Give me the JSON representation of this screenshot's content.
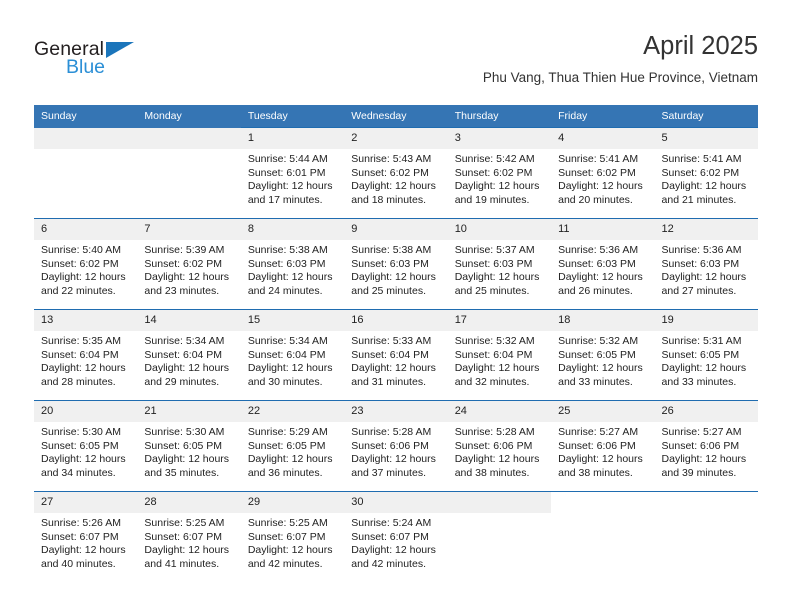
{
  "brand": {
    "name_top": "General",
    "name_bottom": "Blue",
    "triangle_color": "#1b75bb",
    "blue_text_color": "#2b8fd6"
  },
  "header": {
    "month_title": "April 2025",
    "location": "Phu Vang, Thua Thien Hue Province, Vietnam"
  },
  "theme": {
    "header_bg": "#3575b4",
    "row_rule": "#1f6cb0",
    "daynum_bg": "#f0f0f0"
  },
  "calendar": {
    "weekday_headers": [
      "Sunday",
      "Monday",
      "Tuesday",
      "Wednesday",
      "Thursday",
      "Friday",
      "Saturday"
    ],
    "labels": {
      "sunrise_prefix": "Sunrise:",
      "sunset_prefix": "Sunset:",
      "daylight_prefix": "Daylight:"
    },
    "weeks": [
      [
        {
          "day": "",
          "sunrise": "",
          "sunset": "",
          "daylight_line1": "",
          "daylight_line2": ""
        },
        {
          "day": "",
          "sunrise": "",
          "sunset": "",
          "daylight_line1": "",
          "daylight_line2": ""
        },
        {
          "day": "1",
          "sunrise": "Sunrise: 5:44 AM",
          "sunset": "Sunset: 6:01 PM",
          "daylight_line1": "Daylight: 12 hours",
          "daylight_line2": "and 17 minutes."
        },
        {
          "day": "2",
          "sunrise": "Sunrise: 5:43 AM",
          "sunset": "Sunset: 6:02 PM",
          "daylight_line1": "Daylight: 12 hours",
          "daylight_line2": "and 18 minutes."
        },
        {
          "day": "3",
          "sunrise": "Sunrise: 5:42 AM",
          "sunset": "Sunset: 6:02 PM",
          "daylight_line1": "Daylight: 12 hours",
          "daylight_line2": "and 19 minutes."
        },
        {
          "day": "4",
          "sunrise": "Sunrise: 5:41 AM",
          "sunset": "Sunset: 6:02 PM",
          "daylight_line1": "Daylight: 12 hours",
          "daylight_line2": "and 20 minutes."
        },
        {
          "day": "5",
          "sunrise": "Sunrise: 5:41 AM",
          "sunset": "Sunset: 6:02 PM",
          "daylight_line1": "Daylight: 12 hours",
          "daylight_line2": "and 21 minutes."
        }
      ],
      [
        {
          "day": "6",
          "sunrise": "Sunrise: 5:40 AM",
          "sunset": "Sunset: 6:02 PM",
          "daylight_line1": "Daylight: 12 hours",
          "daylight_line2": "and 22 minutes."
        },
        {
          "day": "7",
          "sunrise": "Sunrise: 5:39 AM",
          "sunset": "Sunset: 6:02 PM",
          "daylight_line1": "Daylight: 12 hours",
          "daylight_line2": "and 23 minutes."
        },
        {
          "day": "8",
          "sunrise": "Sunrise: 5:38 AM",
          "sunset": "Sunset: 6:03 PM",
          "daylight_line1": "Daylight: 12 hours",
          "daylight_line2": "and 24 minutes."
        },
        {
          "day": "9",
          "sunrise": "Sunrise: 5:38 AM",
          "sunset": "Sunset: 6:03 PM",
          "daylight_line1": "Daylight: 12 hours",
          "daylight_line2": "and 25 minutes."
        },
        {
          "day": "10",
          "sunrise": "Sunrise: 5:37 AM",
          "sunset": "Sunset: 6:03 PM",
          "daylight_line1": "Daylight: 12 hours",
          "daylight_line2": "and 25 minutes."
        },
        {
          "day": "11",
          "sunrise": "Sunrise: 5:36 AM",
          "sunset": "Sunset: 6:03 PM",
          "daylight_line1": "Daylight: 12 hours",
          "daylight_line2": "and 26 minutes."
        },
        {
          "day": "12",
          "sunrise": "Sunrise: 5:36 AM",
          "sunset": "Sunset: 6:03 PM",
          "daylight_line1": "Daylight: 12 hours",
          "daylight_line2": "and 27 minutes."
        }
      ],
      [
        {
          "day": "13",
          "sunrise": "Sunrise: 5:35 AM",
          "sunset": "Sunset: 6:04 PM",
          "daylight_line1": "Daylight: 12 hours",
          "daylight_line2": "and 28 minutes."
        },
        {
          "day": "14",
          "sunrise": "Sunrise: 5:34 AM",
          "sunset": "Sunset: 6:04 PM",
          "daylight_line1": "Daylight: 12 hours",
          "daylight_line2": "and 29 minutes."
        },
        {
          "day": "15",
          "sunrise": "Sunrise: 5:34 AM",
          "sunset": "Sunset: 6:04 PM",
          "daylight_line1": "Daylight: 12 hours",
          "daylight_line2": "and 30 minutes."
        },
        {
          "day": "16",
          "sunrise": "Sunrise: 5:33 AM",
          "sunset": "Sunset: 6:04 PM",
          "daylight_line1": "Daylight: 12 hours",
          "daylight_line2": "and 31 minutes."
        },
        {
          "day": "17",
          "sunrise": "Sunrise: 5:32 AM",
          "sunset": "Sunset: 6:04 PM",
          "daylight_line1": "Daylight: 12 hours",
          "daylight_line2": "and 32 minutes."
        },
        {
          "day": "18",
          "sunrise": "Sunrise: 5:32 AM",
          "sunset": "Sunset: 6:05 PM",
          "daylight_line1": "Daylight: 12 hours",
          "daylight_line2": "and 33 minutes."
        },
        {
          "day": "19",
          "sunrise": "Sunrise: 5:31 AM",
          "sunset": "Sunset: 6:05 PM",
          "daylight_line1": "Daylight: 12 hours",
          "daylight_line2": "and 33 minutes."
        }
      ],
      [
        {
          "day": "20",
          "sunrise": "Sunrise: 5:30 AM",
          "sunset": "Sunset: 6:05 PM",
          "daylight_line1": "Daylight: 12 hours",
          "daylight_line2": "and 34 minutes."
        },
        {
          "day": "21",
          "sunrise": "Sunrise: 5:30 AM",
          "sunset": "Sunset: 6:05 PM",
          "daylight_line1": "Daylight: 12 hours",
          "daylight_line2": "and 35 minutes."
        },
        {
          "day": "22",
          "sunrise": "Sunrise: 5:29 AM",
          "sunset": "Sunset: 6:05 PM",
          "daylight_line1": "Daylight: 12 hours",
          "daylight_line2": "and 36 minutes."
        },
        {
          "day": "23",
          "sunrise": "Sunrise: 5:28 AM",
          "sunset": "Sunset: 6:06 PM",
          "daylight_line1": "Daylight: 12 hours",
          "daylight_line2": "and 37 minutes."
        },
        {
          "day": "24",
          "sunrise": "Sunrise: 5:28 AM",
          "sunset": "Sunset: 6:06 PM",
          "daylight_line1": "Daylight: 12 hours",
          "daylight_line2": "and 38 minutes."
        },
        {
          "day": "25",
          "sunrise": "Sunrise: 5:27 AM",
          "sunset": "Sunset: 6:06 PM",
          "daylight_line1": "Daylight: 12 hours",
          "daylight_line2": "and 38 minutes."
        },
        {
          "day": "26",
          "sunrise": "Sunrise: 5:27 AM",
          "sunset": "Sunset: 6:06 PM",
          "daylight_line1": "Daylight: 12 hours",
          "daylight_line2": "and 39 minutes."
        }
      ],
      [
        {
          "day": "27",
          "sunrise": "Sunrise: 5:26 AM",
          "sunset": "Sunset: 6:07 PM",
          "daylight_line1": "Daylight: 12 hours",
          "daylight_line2": "and 40 minutes."
        },
        {
          "day": "28",
          "sunrise": "Sunrise: 5:25 AM",
          "sunset": "Sunset: 6:07 PM",
          "daylight_line1": "Daylight: 12 hours",
          "daylight_line2": "and 41 minutes."
        },
        {
          "day": "29",
          "sunrise": "Sunrise: 5:25 AM",
          "sunset": "Sunset: 6:07 PM",
          "daylight_line1": "Daylight: 12 hours",
          "daylight_line2": "and 42 minutes."
        },
        {
          "day": "30",
          "sunrise": "Sunrise: 5:24 AM",
          "sunset": "Sunset: 6:07 PM",
          "daylight_line1": "Daylight: 12 hours",
          "daylight_line2": "and 42 minutes."
        },
        {
          "day": "",
          "sunrise": "",
          "sunset": "",
          "daylight_line1": "",
          "daylight_line2": ""
        },
        {
          "day": "",
          "sunrise": "",
          "sunset": "",
          "daylight_line1": "",
          "daylight_line2": ""
        },
        {
          "day": "",
          "sunrise": "",
          "sunset": "",
          "daylight_line1": "",
          "daylight_line2": ""
        }
      ]
    ]
  }
}
